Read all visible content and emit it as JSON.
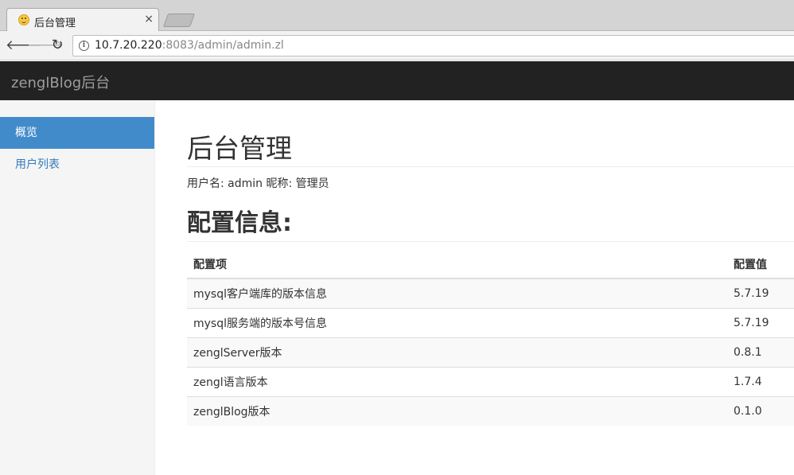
{
  "browser": {
    "tab_title": "后台管理",
    "close_glyph": "×",
    "url_host": "10.7.20.220",
    "url_rest": ":8083/admin/admin.zl"
  },
  "app": {
    "brand": "zenglBlog后台"
  },
  "sidebar": {
    "items": [
      {
        "label": "概览",
        "active": true
      },
      {
        "label": "用户列表",
        "active": false
      }
    ]
  },
  "main": {
    "title": "后台管理",
    "user_line": "用户名: admin 昵称: 管理员",
    "section_title": "配置信息:",
    "table": {
      "headers": [
        "配置项",
        "配置值"
      ],
      "rows": [
        [
          "mysql客户端库的版本信息",
          "5.7.19"
        ],
        [
          "mysql服务端的版本号信息",
          "5.7.19"
        ],
        [
          "zenglServer版本",
          "0.8.1"
        ],
        [
          "zengl语言版本",
          "1.7.4"
        ],
        [
          "zenglBlog版本",
          "0.1.0"
        ]
      ]
    }
  }
}
